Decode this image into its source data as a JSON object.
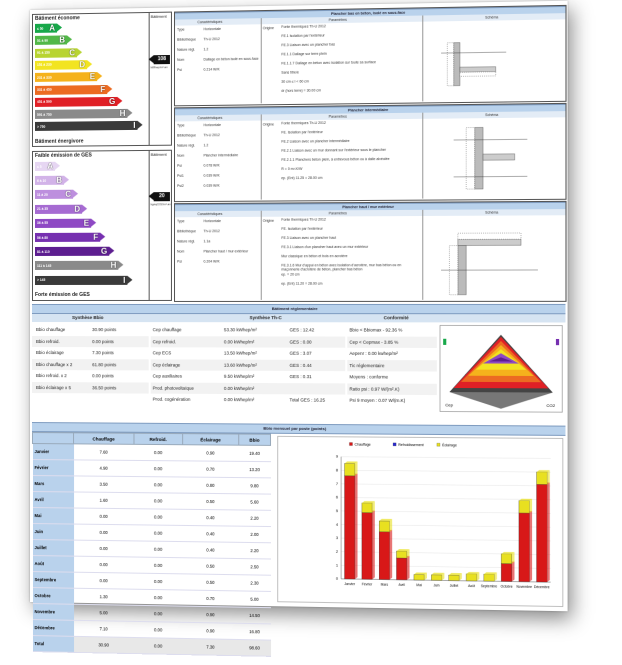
{
  "energy": {
    "title": "Bâtiment économe",
    "sub_title": "Bâtiment",
    "footer": "Bâtiment énergivore",
    "value": "108",
    "unit": "kWhep/m².an",
    "classes": [
      {
        "range": "≤ 50",
        "letter": "A",
        "color": "#18a84a"
      },
      {
        "range": "51 à 90",
        "letter": "B",
        "color": "#52b848"
      },
      {
        "range": "91 à 150",
        "letter": "C",
        "color": "#b8d432"
      },
      {
        "range": "151 à 230",
        "letter": "D",
        "color": "#f2e421"
      },
      {
        "range": "231 à 330",
        "letter": "E",
        "color": "#f5b21c"
      },
      {
        "range": "331 à 450",
        "letter": "F",
        "color": "#ec6b22"
      },
      {
        "range": "451 à 590",
        "letter": "G",
        "color": "#e02026"
      },
      {
        "range": "591 à 750",
        "letter": "H",
        "color": "#8a8a8a"
      },
      {
        "range": "> 750",
        "letter": "I",
        "color": "#3a3a3a"
      }
    ]
  },
  "ges": {
    "title": "Faible émission de GES",
    "sub_title": "Bâtiment",
    "footer": "Forte émission de GES",
    "value": "20",
    "unit": "kgéqCO2/m².an",
    "classes": [
      {
        "range": "≤ 5",
        "letter": "A",
        "color": "#e6d6f2"
      },
      {
        "range": "6 à 10",
        "letter": "B",
        "color": "#d2b3e8"
      },
      {
        "range": "11 à 20",
        "letter": "C",
        "color": "#bd8fde"
      },
      {
        "range": "21 à 35",
        "letter": "D",
        "color": "#a66bd2"
      },
      {
        "range": "36 à 55",
        "letter": "E",
        "color": "#8e49c4"
      },
      {
        "range": "56 à 80",
        "letter": "F",
        "color": "#7630b0"
      },
      {
        "range": "81 à 110",
        "letter": "G",
        "color": "#5d1e90"
      },
      {
        "range": "111 à 145",
        "letter": "H",
        "color": "#8a8a8a"
      },
      {
        "range": "> 145",
        "letter": "I",
        "color": "#3a3a3a"
      }
    ]
  },
  "details": {
    "col_caracteristiques": "Caractéristiques",
    "col_parametres": "Paramètres",
    "col_schema": "Schéma",
    "sections": [
      {
        "title": "Plancher bas en béton, isolé en sous-face",
        "rows": [
          {
            "k": "Type",
            "v": "Horizontale"
          },
          {
            "k": "Bibliothèque",
            "v": "Th-U 2012"
          },
          {
            "k": "Nature règl.",
            "v": "1.2"
          },
          {
            "k": "Nom",
            "v": "Dallage en béton isolé en sous-face"
          },
          {
            "k": "Psi",
            "v": "0.214 W/K"
          }
        ],
        "origine": "Origine",
        "params": [
          "Fonte thermiques Th-U 2012",
          "FE.1 Isolation par l'extérieur",
          "FE.3 Liaison avec un plancher bas",
          "FE.1.1 Dallage sur terre plein",
          "FE.1.1.7 Dallage en béton avec isolation sur toute sa surface",
          "Sans titre/e",
          "30 cm ≤ l < 60 cm",
          "dr (hors terre) = 30.00 cm"
        ]
      },
      {
        "title": "Plancher intermédiaire",
        "rows": [
          {
            "k": "Type",
            "v": "Horizontale"
          },
          {
            "k": "Bibliothèque",
            "v": "Th-U 2012"
          },
          {
            "k": "Nature règl.",
            "v": "1.2"
          },
          {
            "k": "Nom",
            "v": "Plancher intermédiaire"
          },
          {
            "k": "Psi",
            "v": "0.078 W/K"
          },
          {
            "k": "Psi1",
            "v": "0.039 W/K"
          },
          {
            "k": "Psi2",
            "v": "0.039 W/K"
          }
        ],
        "origine": "Origine",
        "params": [
          "Fonte thermiques Th-U 2012",
          "FE. Isolation par l'extérieur",
          "FE.2 Liaison avec un plancher intermédiaire",
          "FE.2.1 Liaison avec un mur donnant sur l'extérieur sous le plancher",
          "FE.2.1.1 Planchers béton plein, à entrevous béton ou à dalle alvéolée",
          "R = 0 m².K/W",
          "ep. (Ent) 11.25 = 28.00 cm"
        ]
      },
      {
        "title": "Plancher haut / mur extérieur",
        "rows": [
          {
            "k": "Type",
            "v": "Horizontale"
          },
          {
            "k": "Bibliothèque",
            "v": "Th-U 2012"
          },
          {
            "k": "Nature règl.",
            "v": "1.1a"
          },
          {
            "k": "Nom",
            "v": "Plancher haut / mur extérieur"
          },
          {
            "k": "Psi",
            "v": "0.204 W/K"
          }
        ],
        "origine": "Origine",
        "params": [
          "Fonte thermiques Th-U 2012",
          "FE. Isolation par l'extérieur",
          "FE.3 Liaison avec un plancher haut",
          "FE.3.1 Liaison d'un plancher haut avec un mur extérieur",
          "Mur classique en béton et bois en acrotère",
          "FE.3.1.6 Mur d'appui en béton avec isolation d'acrotère, mur bas béton ou en maçonnerie d'acrotère de béton, plancher bas béton",
          "ep. = 20 cm",
          "ep. (Ent) 11.20 = 28.00 cm"
        ]
      }
    ]
  },
  "reg": {
    "band": "Bâtiment réglementaire",
    "bbio_header": "Synthèse Bbio",
    "thc_header": "Synthèse Th-C",
    "conf_header": "Conformité",
    "bbio_rows": [
      {
        "k": "Bbio chauffage",
        "v": "30.90 points"
      },
      {
        "k": "Bbio refroid.",
        "v": "0.00 points"
      },
      {
        "k": "Bbio éclairage",
        "v": "7.30 points"
      },
      {
        "k": "Bbio chauffage x 2",
        "v": "61.80 points"
      },
      {
        "k": "Bbio refroid. x 2",
        "v": "0.00 points"
      },
      {
        "k": "Bbio éclairage x 5",
        "v": "36.50 points"
      }
    ],
    "thc_rows": [
      {
        "k": "Cep chauffage",
        "v": "53.30 kWhep/m²",
        "g": "GES : 12.42"
      },
      {
        "k": "Cep refroid.",
        "v": "0.00 kWhep/m²",
        "g": "GES : 0.00"
      },
      {
        "k": "Cep ECS",
        "v": "13.50 kWhep/m²",
        "g": "GES : 3.07"
      },
      {
        "k": "Cep éclairage",
        "v": "13.60 kWhep/m²",
        "g": "GES : 0.44"
      },
      {
        "k": "Cep auxiliaires",
        "v": "9.50 kWhep/m²",
        "g": "GES : 0.31"
      },
      {
        "k": "Prod. photovoltaïque",
        "v": "0.00 kWhep/m²",
        "g": ""
      },
      {
        "k": "Prod. cogénération",
        "v": "0.00 kWhep/m²",
        "g": "Total GES : 16.25"
      }
    ],
    "conf_rows": [
      "Bbio < Bbiomax - 92.36 %",
      "Cep < Cepmax - 3.85 %",
      "Aepenr : 0.00 kwhep/m²",
      "Tic réglementaire",
      "Moyens : conforme",
      "Ratio psi : 0.97 W/(m².K)",
      "Psi 9 moyen : 0.07 W/(m.K)"
    ],
    "pyramid_left": "Cep",
    "pyramid_right": "CO2"
  },
  "monthly": {
    "band": "Bbio mensuel par poste (points)",
    "headers": [
      "Chauffage",
      "Refroid.",
      "Éclairage",
      "Bbio"
    ],
    "rows": [
      {
        "m": "Janvier",
        "c": "7.60",
        "r": "0.00",
        "e": "0.90",
        "b": "19.40"
      },
      {
        "m": "Février",
        "c": "4.90",
        "r": "0.00",
        "e": "0.70",
        "b": "13.20"
      },
      {
        "m": "Mars",
        "c": "3.50",
        "r": "0.00",
        "e": "0.80",
        "b": "9.80"
      },
      {
        "m": "Avril",
        "c": "1.60",
        "r": "0.00",
        "e": "0.50",
        "b": "5.60"
      },
      {
        "m": "Mai",
        "c": "0.00",
        "r": "0.00",
        "e": "0.40",
        "b": "2.20"
      },
      {
        "m": "Juin",
        "c": "0.00",
        "r": "0.00",
        "e": "0.40",
        "b": "2.00"
      },
      {
        "m": "Juillet",
        "c": "0.00",
        "r": "0.00",
        "e": "0.40",
        "b": "2.20"
      },
      {
        "m": "Août",
        "c": "0.00",
        "r": "0.00",
        "e": "0.50",
        "b": "2.50"
      },
      {
        "m": "Septembre",
        "c": "0.00",
        "r": "0.00",
        "e": "0.50",
        "b": "2.30"
      },
      {
        "m": "Octobre",
        "c": "1.30",
        "r": "0.00",
        "e": "0.70",
        "b": "5.00"
      },
      {
        "m": "Novembre",
        "c": "5.00",
        "r": "0.00",
        "e": "0.90",
        "b": "14.50"
      },
      {
        "m": "Décembre",
        "c": "7.10",
        "r": "0.00",
        "e": "0.90",
        "b": "16.80"
      },
      {
        "m": "Total",
        "c": "30.90",
        "r": "0.00",
        "e": "7.30",
        "b": "98.60"
      }
    ]
  },
  "chart_data": {
    "type": "bar",
    "stacked": true,
    "categories": [
      "Janvier",
      "Février",
      "Mars",
      "Avril",
      "Mai",
      "Juin",
      "Juillet",
      "Août",
      "Septembre",
      "Octobre",
      "Novembre",
      "Décembre"
    ],
    "series": [
      {
        "name": "Chauffage",
        "color": "#d81818",
        "values": [
          7.6,
          4.9,
          3.5,
          1.6,
          0,
          0,
          0,
          0,
          0,
          1.3,
          5.0,
          7.1
        ]
      },
      {
        "name": "Refroidissement",
        "color": "#2a2ad0",
        "values": [
          0,
          0,
          0,
          0,
          0,
          0,
          0,
          0,
          0,
          0,
          0,
          0
        ]
      },
      {
        "name": "Éclairage",
        "color": "#e8e020",
        "values": [
          0.9,
          0.7,
          0.8,
          0.5,
          0.4,
          0.4,
          0.4,
          0.5,
          0.5,
          0.7,
          0.9,
          0.9
        ]
      }
    ],
    "yticks": [
      "0",
      "1",
      "2",
      "3",
      "4",
      "5",
      "6",
      "7",
      "8",
      "9"
    ],
    "ylim": [
      0,
      9
    ]
  }
}
